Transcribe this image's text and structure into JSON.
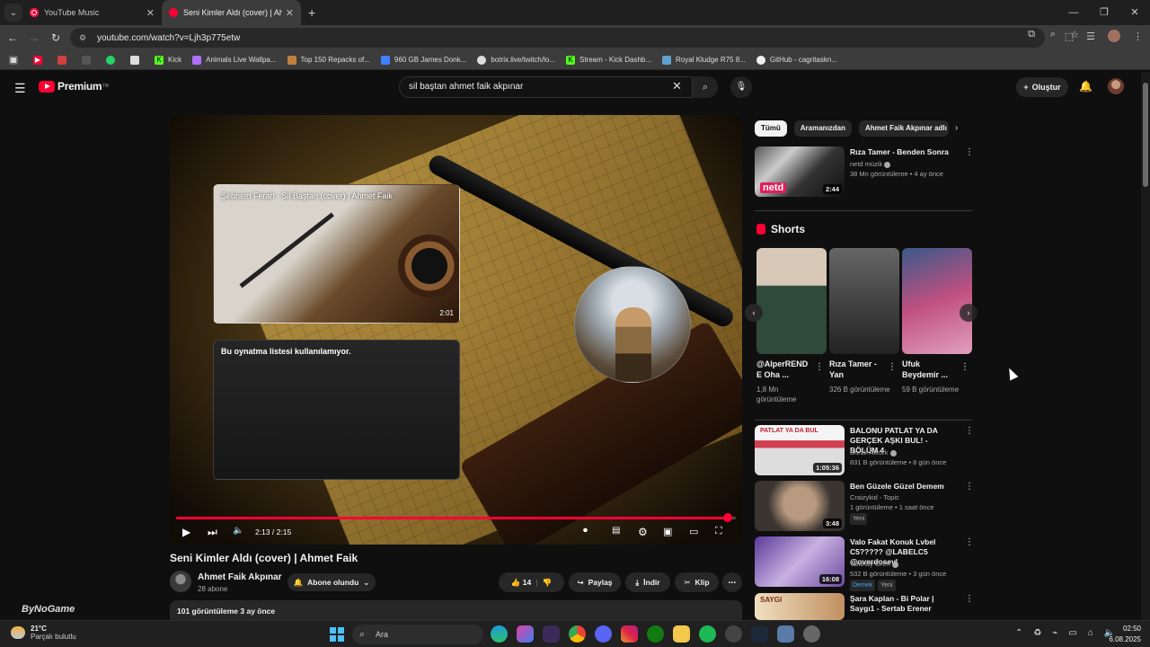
{
  "browser": {
    "tabs": [
      {
        "title": "YouTube Music"
      },
      {
        "title": "Seni Kimler Aldı (cover) | Ahmet"
      }
    ],
    "url": "youtube.com/watch?v=Ljh3p775etw",
    "bookmarks": [
      {
        "label": "Kick",
        "color": "#53fc18"
      },
      {
        "label": "Animals Live Wallpa...",
        "color": "#b070ff"
      },
      {
        "label": "Top 150 Repacks of...",
        "color": "#c08040"
      },
      {
        "label": "960 GB James Donk...",
        "color": "#4080ff"
      },
      {
        "label": "botrix.live/twitch/lo...",
        "color": "#dddddd"
      },
      {
        "label": "Stream - Kick Dashb...",
        "color": "#53fc18"
      },
      {
        "label": "Royal Kludge R75 8...",
        "color": "#60a0d0"
      },
      {
        "label": "GitHub - cagritaskn...",
        "color": "#f0f0f0"
      }
    ]
  },
  "yt": {
    "logo": "Premium",
    "region": "TR",
    "search_query": "sil baştan ahmet faik akpınar",
    "create": "Oluştur"
  },
  "player": {
    "card1_title": "Şebnem Ferah - Sil Baştan (cover) | Ahmet Faik",
    "card1_duration": "2:01",
    "card2_title": "Bu oynatma listesi kullanılamıyor.",
    "time": "2:13 / 2:15",
    "progress": 0.985
  },
  "video": {
    "title": "Seni Kimler Aldı (cover) | Ahmet Faik",
    "channel": "Ahmet Faik Akpınar",
    "subscribers": "28 abone",
    "subscribe_label": "Abone olundu",
    "likes": "14",
    "share": "Paylaş",
    "download": "İndir",
    "clip": "Klip",
    "views_date": "101 görüntüleme  3 ay önce"
  },
  "chips": [
    "Tümü",
    "Aramanızdan",
    "Ahmet Faik Akpınar adlı"
  ],
  "rec_top": {
    "title": "Rıza Tamer - Benden Sonra",
    "channel": "netd müzik",
    "meta": "38 Mn görüntüleme • 4 ay önce",
    "duration": "2:44",
    "logo": "netd"
  },
  "shorts": {
    "heading": "Shorts",
    "items": [
      {
        "title": "@AlperREND E Oha ...",
        "views": "1,8 Mn görüntüleme"
      },
      {
        "title": "Rıza Tamer - Yan",
        "views": "326 B görüntüleme"
      },
      {
        "title": "Ufuk Beydemir ...",
        "views": "59 B görüntüleme"
      }
    ]
  },
  "recs": [
    {
      "title": "BALONU PATLAT YA DA GERÇEK AŞKI BUL! - BÖLÜM 4",
      "channel": "Burak Aktürk",
      "meta": "831 B görüntüleme • 8 gün önce",
      "duration": "1:05:36",
      "thumb_text": "PATLAT YA DA BUL",
      "badges": []
    },
    {
      "title": "Ben Güzele Güzel Demem",
      "channel": "Craizykid - Topic",
      "meta": "1 görüntüleme • 1 saat önce",
      "duration": "3:48",
      "badges": [
        "Yeni"
      ]
    },
    {
      "title": "Valo Fakat Konuk Lvbel C5????? @LABELC5 @overdosevl",
      "channel": "Tolunay Ören",
      "meta": "532 B görüntüleme • 3 gün önce",
      "duration": "16:08",
      "badges": [
        "Demek",
        "Yeni"
      ]
    },
    {
      "title": "Şara Kaplan - Bi Polar | Saygı1 - Sertab Erener",
      "channel": "",
      "meta": "",
      "duration": "",
      "thumb_text": "SAYGI",
      "badges": []
    }
  ],
  "taskbar": {
    "temp": "21°C",
    "condition": "Parçalı bulutlu",
    "watermark": "ByNoGame",
    "search": "Ara",
    "time": "02:50",
    "date": "6.08.2025"
  }
}
